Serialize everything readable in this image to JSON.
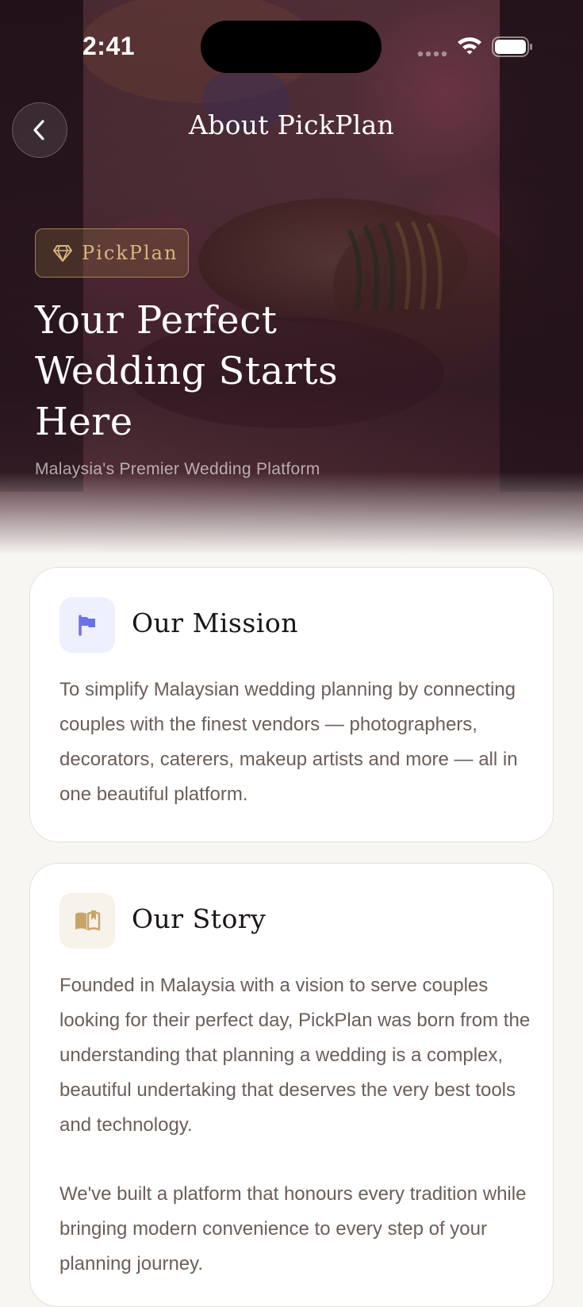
{
  "status_bar": {
    "time": "2:41",
    "icons": [
      "signal-icon",
      "wifi-icon",
      "battery-icon"
    ]
  },
  "nav": {
    "title": "About PickPlan",
    "back_icon": "chevron-left-icon"
  },
  "hero": {
    "badge_icon": "diamond-icon",
    "badge_label": "PickPlan",
    "title": "Your Perfect Wedding Starts Here",
    "subtitle": "Malaysia's Premier Wedding Platform"
  },
  "mission": {
    "icon": "flag-icon",
    "title": "Our Mission",
    "body": "To simplify Malaysian wedding planning by connecting couples with the finest vendors — photographers, decorators, caterers, makeup artists and more — all in one beautiful platform."
  },
  "story": {
    "icon": "open-book-icon",
    "title": "Our Story",
    "body_1": "Founded in Malaysia with a vision to serve couples looking for their perfect day, PickPlan was born from the understanding that planning a wedding is a complex, beautiful undertaking that deserves the very best tools and technology.",
    "body_2": "We've built a platform that honours every tradition while bringing modern convenience to every step of your planning journey."
  },
  "colors": {
    "accent_gold": "#d9b67c",
    "hero_dark": "#1c0e16",
    "mission_icon": "#6c72e8",
    "story_icon": "#c8a46a",
    "body_text": "#6b5e58",
    "page_bg": "#f8f6f3"
  }
}
